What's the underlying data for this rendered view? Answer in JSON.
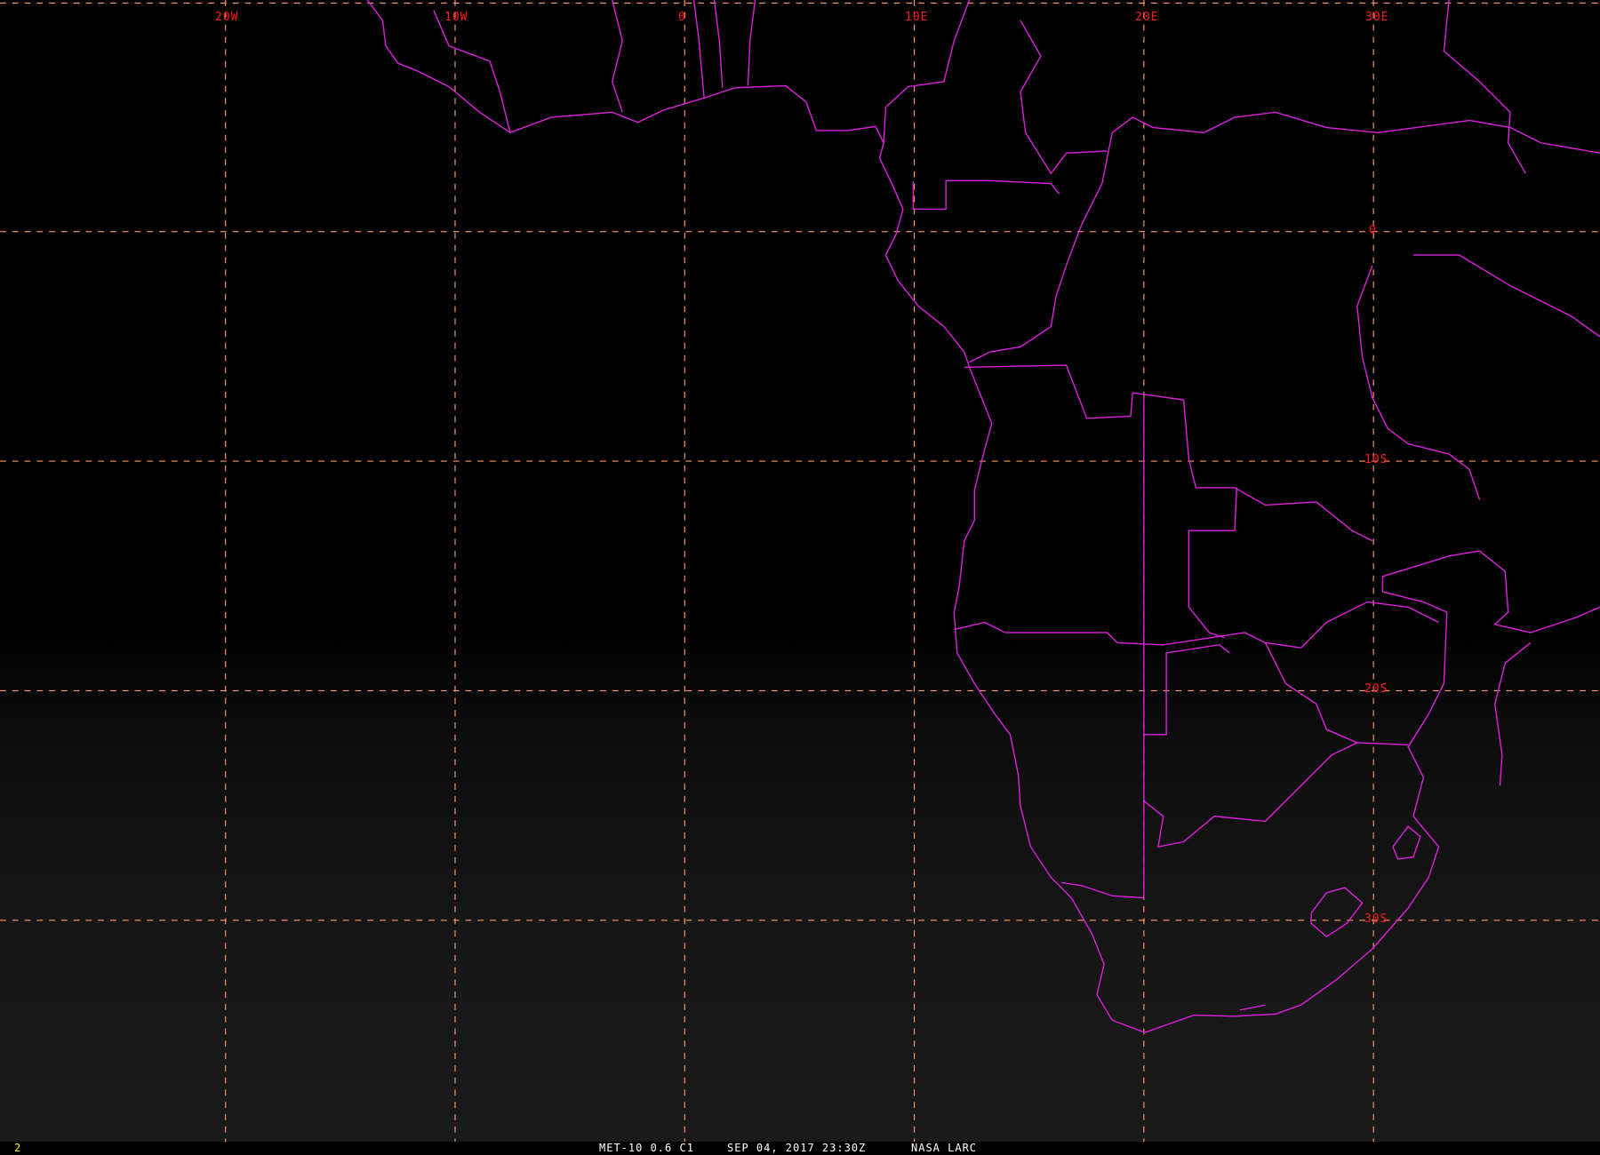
{
  "map": {
    "lon_labels": [
      "20W",
      "10W",
      "0",
      "10E",
      "20E",
      "30E"
    ],
    "lat_labels": [
      "0",
      "10S",
      "20S",
      "30S"
    ],
    "colors": {
      "grid": "#ff9966",
      "label": "#ff1a1a",
      "borders": "#e020e0"
    }
  },
  "status_bar": {
    "frame_number": "2",
    "satellite": "MET-10 0.6 C1",
    "datetime": "SEP 04, 2017 23:30Z",
    "source": "NASA LARC"
  }
}
